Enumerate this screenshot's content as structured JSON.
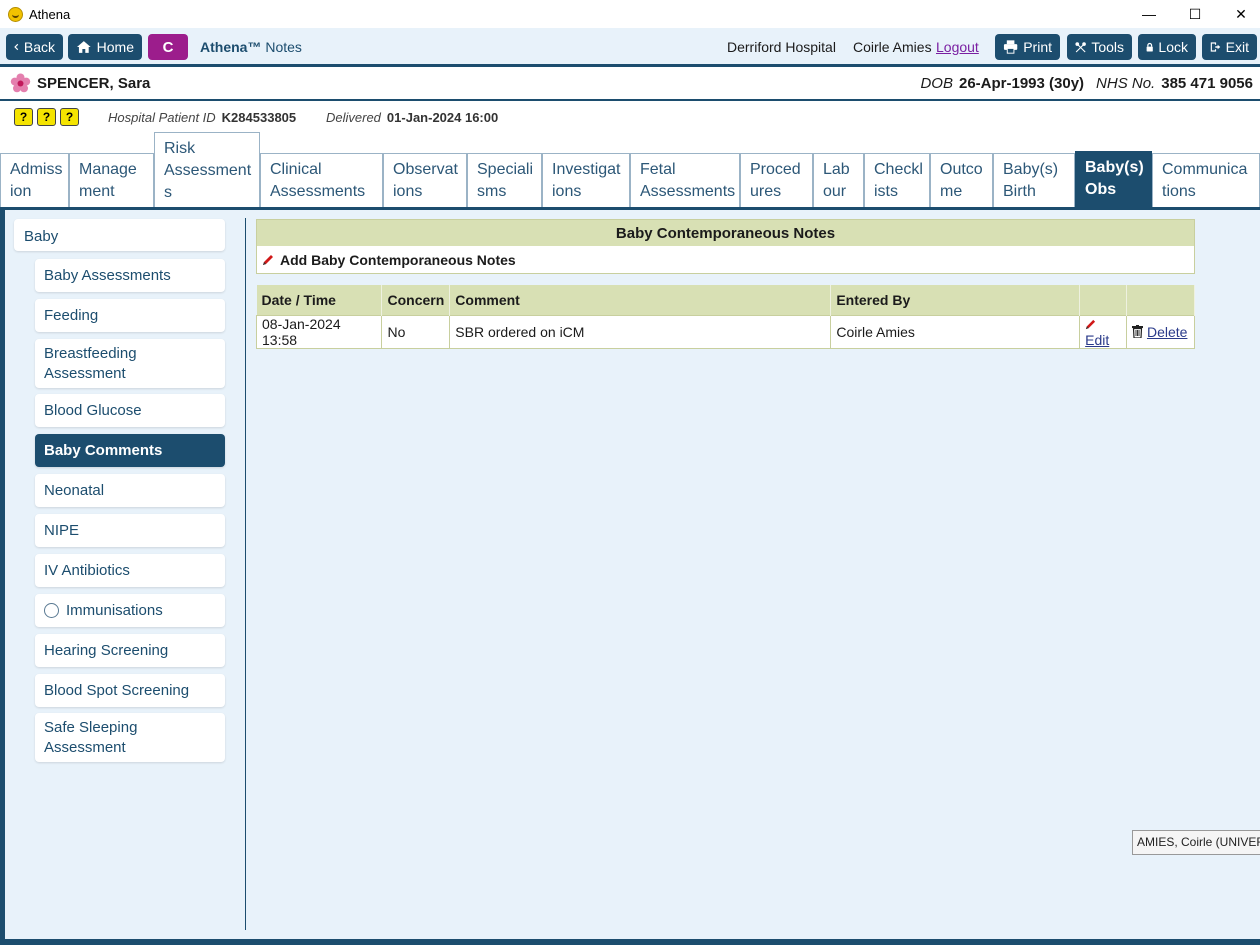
{
  "window": {
    "title": "Athena",
    "controls": {
      "minimize": "—",
      "maximize": "☐",
      "close": "✕"
    }
  },
  "toolbar": {
    "back_label": "Back",
    "home_label": "Home",
    "user_initial": "C",
    "brand_name": "Athena™",
    "brand_section": "Notes",
    "hospital": "Derriford Hospital",
    "user_name": "Coirle Amies",
    "logout_label": "Logout",
    "print_label": "Print",
    "tools_label": "Tools",
    "lock_label": "Lock",
    "exit_label": "Exit"
  },
  "patient": {
    "name": "SPENCER, Sara",
    "dob_label": "DOB",
    "dob_value": "26-Apr-1993 (30y)",
    "nhs_label": "NHS No.",
    "nhs_value": "385 471 9056",
    "hospital_id_label": "Hospital Patient ID",
    "hospital_id_value": "K284533805",
    "delivered_label": "Delivered",
    "delivered_value": "01-Jan-2024 16:00"
  },
  "alerts": [
    "?",
    "?",
    "?"
  ],
  "tabs": [
    {
      "label": "Admiss\nion"
    },
    {
      "label": "Manage\nment"
    },
    {
      "label": "Risk\nAssessment\ns"
    },
    {
      "label": "Clinical\nAssessments"
    },
    {
      "label": "Observat\nions"
    },
    {
      "label": "Speciali\nsms"
    },
    {
      "label": "Investigat\nions"
    },
    {
      "label": "Fetal\nAssessments"
    },
    {
      "label": "Proced\nures"
    },
    {
      "label": "Lab\nour"
    },
    {
      "label": "Checkl\nists"
    },
    {
      "label": "Outco\nme"
    },
    {
      "label": "Baby(s)\nBirth"
    },
    {
      "label": "Baby(s)\nObs"
    },
    {
      "label": "Communica\ntions"
    }
  ],
  "sidebar": {
    "root": "Baby",
    "items": [
      {
        "label": "Baby Assessments"
      },
      {
        "label": "Feeding"
      },
      {
        "label": "Breastfeeding Assessment"
      },
      {
        "label": "Blood Glucose"
      },
      {
        "label": "Baby Comments"
      },
      {
        "label": "Neonatal"
      },
      {
        "label": "NIPE"
      },
      {
        "label": "IV Antibiotics"
      },
      {
        "label": "Immunisations"
      },
      {
        "label": "Hearing Screening"
      },
      {
        "label": "Blood Spot Screening"
      },
      {
        "label": "Safe Sleeping Assessment"
      }
    ]
  },
  "main": {
    "panel_title": "Baby Contemporaneous Notes",
    "add_label": "Add Baby Contemporaneous Notes",
    "columns": [
      "Date / Time",
      "Concern",
      "Comment",
      "Entered By"
    ],
    "rows": [
      {
        "datetime": "08-Jan-2024 13:58",
        "concern": "No",
        "comment": "SBR ordered on iCM",
        "entered_by": "Coirle Amies",
        "edit": "Edit",
        "delete": "Delete"
      }
    ]
  },
  "tooltip": "AMIES, Coirle (UNIVERS"
}
